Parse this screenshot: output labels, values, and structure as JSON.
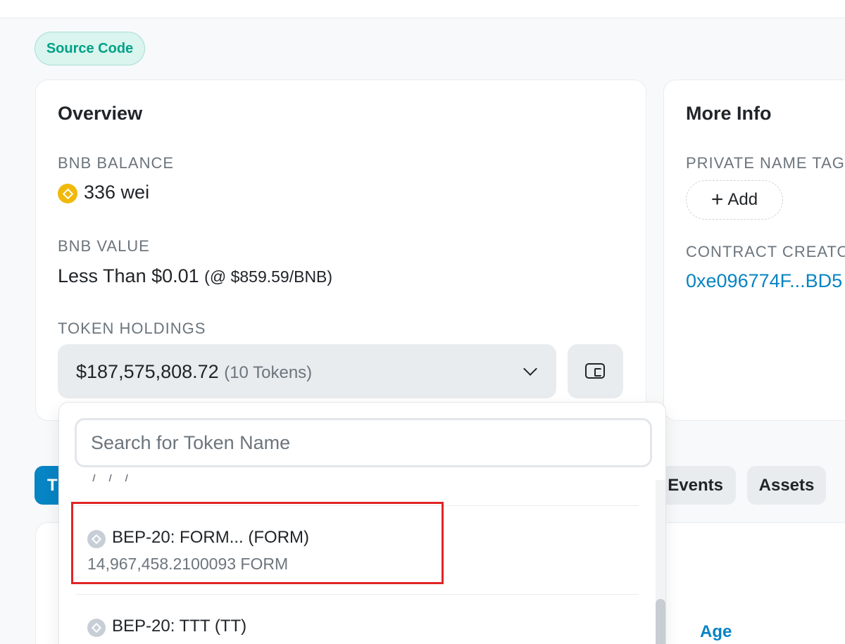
{
  "source_code_badge": "Source Code",
  "overview": {
    "title": "Overview",
    "bnb_balance_label": "BNB BALANCE",
    "bnb_balance_value": "336 wei",
    "bnb_value_label": "BNB VALUE",
    "bnb_value_main": "Less Than $0.01",
    "bnb_value_price": "(@ $859.59/BNB)",
    "token_holdings_label": "TOKEN HOLDINGS",
    "token_holdings_amount": "$187,575,808.72",
    "token_holdings_count": "(10 Tokens)"
  },
  "more_info": {
    "title": "More Info",
    "private_name_tag_label": "PRIVATE NAME TAG",
    "add_label": "Add",
    "contract_creator_label": "CONTRACT CREATOR",
    "contract_creator_value": "0xe096774F...BD5"
  },
  "tabs": {
    "active_label": "T",
    "events_label": "Events",
    "assets_label": "Assets"
  },
  "table": {
    "age_header": "Age"
  },
  "token_dropdown": {
    "search_placeholder": "Search for Token Name",
    "cut_off_text": "/ / /",
    "items": [
      {
        "name": "BEP-20: FORM... (FORM)",
        "balance": "14,967,458.2100093 FORM"
      },
      {
        "name": "BEP-20: TTT (TT)",
        "balance": ""
      }
    ]
  },
  "colors": {
    "accent": "#0784c3",
    "badge_text": "#00a186",
    "bnb_gold": "#f0b90b",
    "highlight_red": "#e02424"
  }
}
